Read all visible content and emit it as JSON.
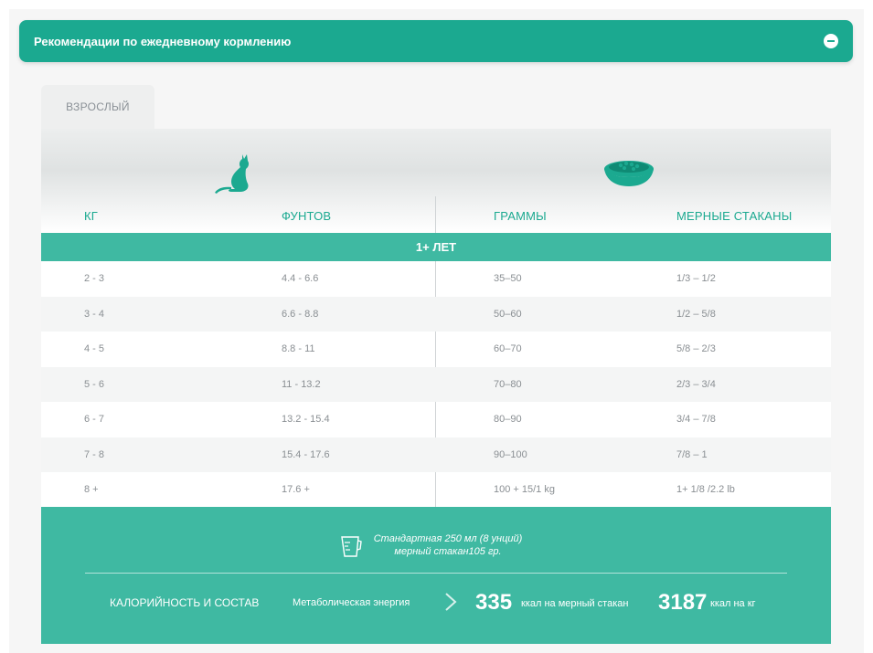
{
  "header": {
    "title": "Рекомендации по ежедневному кормлению"
  },
  "tab": {
    "label": "ВЗРОСЛЫЙ"
  },
  "columns": [
    "КГ",
    "ФУНТОВ",
    "ГРАММЫ",
    "МЕРНЫЕ СТАКАНЫ"
  ],
  "age_group": "1+ ЛЕТ",
  "rows": [
    [
      "2 - 3",
      "4.4 - 6.6",
      "35–50",
      "1/3 – 1/2"
    ],
    [
      "3 - 4",
      "6.6 - 8.8",
      "50–60",
      "1/2 – 5/8"
    ],
    [
      "4 - 5",
      "8.8 - 11",
      "60–70",
      "5/8 – 2/3"
    ],
    [
      "5 - 6",
      "11 - 13.2",
      "70–80",
      "2/3 – 3/4"
    ],
    [
      "6 - 7",
      "13.2 - 15.4",
      "80–90",
      "3/4 – 7/8"
    ],
    [
      "7 - 8",
      "15.4 - 17.6",
      "90–100",
      "7/8 – 1"
    ],
    [
      "8 +",
      "17.6 +",
      "100 + 15/1 kg",
      "1+ 1/8 /2.2 lb"
    ]
  ],
  "footer": {
    "cup_line1": "Стандартная 250 мл (8 унций)",
    "cup_line2": "мерный стакан105 гр.",
    "calories_label": "КАЛОРИЙНОСТЬ И СОСТАВ",
    "metabolic_label": "Метаболическая энергия",
    "kcal_per_cup_value": "335",
    "kcal_per_cup_unit": "ккал на мерный стакан",
    "kcal_per_kg_value": "3187",
    "kcal_per_kg_unit": "ккал на кг"
  },
  "colors": {
    "accent": "#1ba990",
    "accent_light": "#3fb9a2",
    "text_gray": "#8a8f93"
  },
  "icons": [
    "minus-icon",
    "cat-icon",
    "bowl-icon",
    "measuring-cup-icon",
    "chevron-right-icon"
  ]
}
